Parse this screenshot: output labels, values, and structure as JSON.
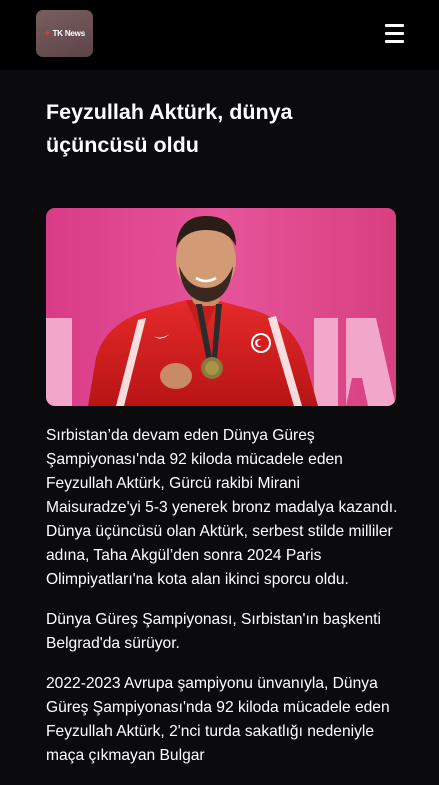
{
  "header": {
    "logo_text": "TK News",
    "menu_icon": "hamburger-menu-icon"
  },
  "article": {
    "title": "Feyzullah Aktürk, dünya üçüncüsü oldu",
    "hero_image": "photo of wrestler in red Turkey jacket holding a bronze medal",
    "paragraphs": [
      "Sırbistan’da devam eden Dünya Güreş Şampiyonası'nda 92 kiloda mücadele eden Feyzullah Aktürk, Gürcü rakibi Mirani Maisuradze'yi 5-3 yenerek bronz madalya kazandı. Dünya üçüncüsü olan Aktürk, serbest stilde milliler adına, Taha Akgül’den sonra 2024 Paris Olimpiyatları'na kota alan ikinci sporcu oldu.",
      "Dünya Güreş Şampiyonası, Sırbistan'ın başkenti Belgrad'da sürüyor.",
      "2022-2023 Avrupa şampiyonu ünvanıyla, Dünya Güreş Şampiyonası'nda 92 kiloda mücadele eden Feyzullah Aktürk, 2'nci turda sakatlığı nedeniyle maça çıkmayan Bulgar"
    ]
  },
  "colors": {
    "background": "#0b0b0d",
    "topbar": "#000000",
    "logo_bg": "#6b5052",
    "text": "#ffffff",
    "photo_backdrop": "#e0478d"
  }
}
